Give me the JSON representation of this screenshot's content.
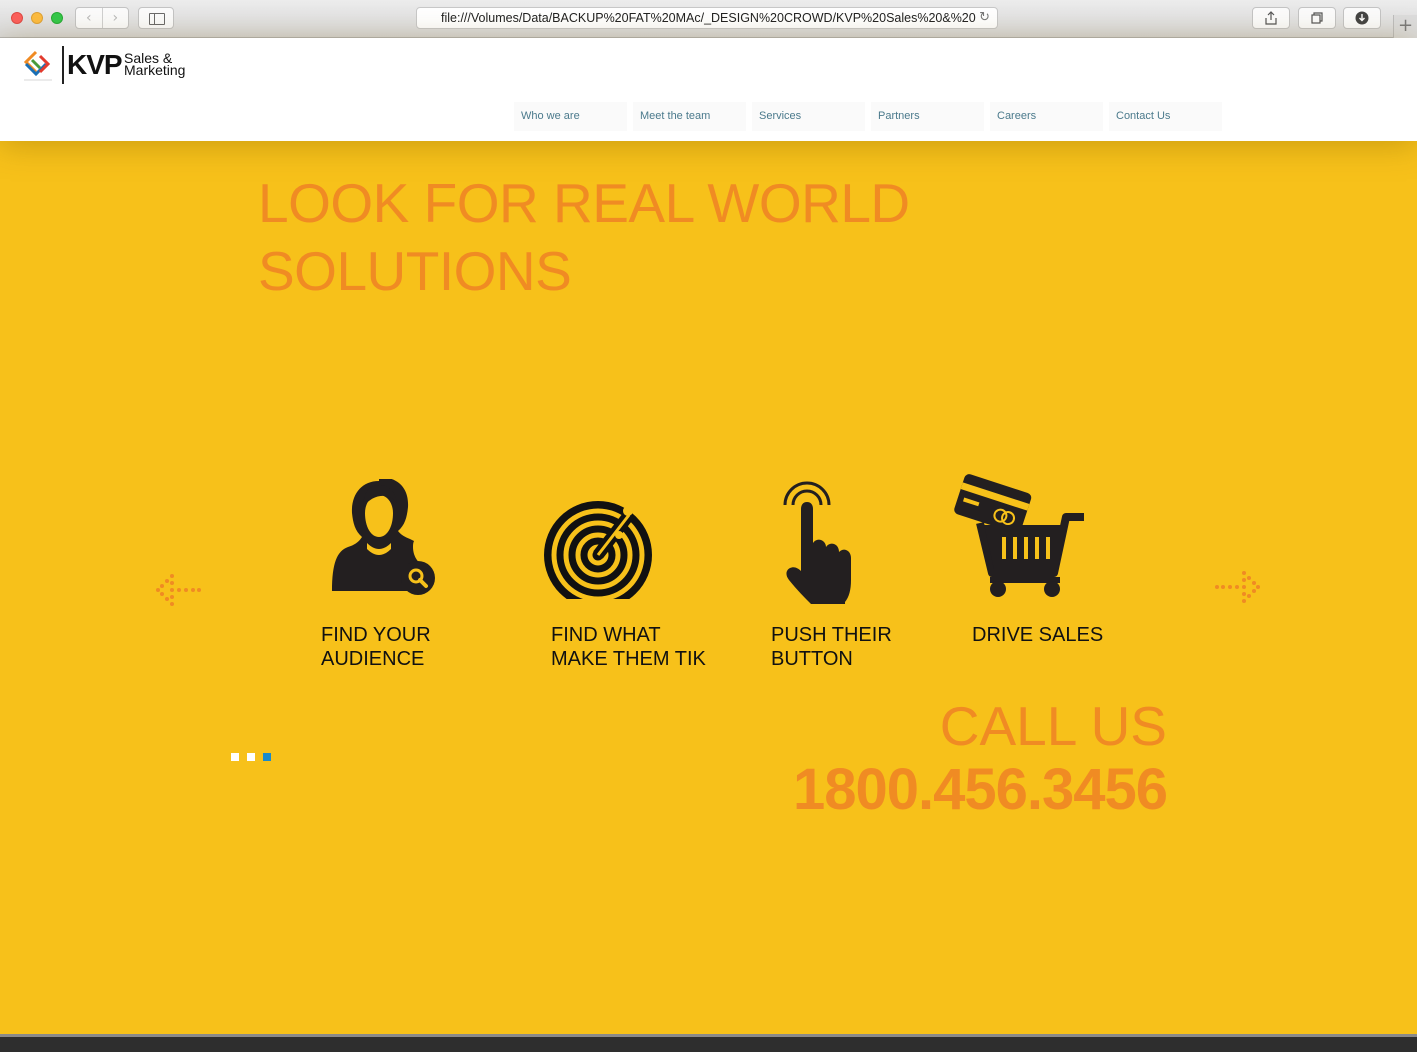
{
  "browser": {
    "url": "file:///Volumes/Data/BACKUP%20FAT%20MAc/_DESIGN%20CROWD/KVP%20Sales%20&%20",
    "back_icon": "chevron-left-icon",
    "forward_icon": "chevron-right-icon",
    "reload_icon": "reload-icon",
    "share_icon": "share-icon",
    "tabs_icon": "tabs-icon",
    "download_icon": "download-icon",
    "newtab_icon": "plus-icon"
  },
  "header": {
    "logo_main": "KVP",
    "logo_sub_line1": "Sales &",
    "logo_sub_line2": "Marketing"
  },
  "nav": {
    "items": [
      {
        "label": "Who we are"
      },
      {
        "label": "Meet the team"
      },
      {
        "label": "Services"
      },
      {
        "label": "Partners"
      },
      {
        "label": "Careers"
      },
      {
        "label": "Contact Us"
      }
    ]
  },
  "hero": {
    "title_line1": "LOOK FOR REAL WORLD",
    "title_line2": "SOLUTIONS",
    "features": [
      {
        "icon": "person-search-icon",
        "line1": "FIND YOUR",
        "line2": "AUDIENCE"
      },
      {
        "icon": "radar-icon",
        "line1": "FIND WHAT",
        "line2": "MAKE THEM TIK"
      },
      {
        "icon": "hand-pointer-icon",
        "line1": "PUSH THEIR",
        "line2": "BUTTON"
      },
      {
        "icon": "shopping-cart-icon",
        "line1": "DRIVE SALES",
        "line2": ""
      }
    ],
    "carousel_slide_count": 3,
    "carousel_active_index": 2,
    "call_label": "CALL US",
    "phone": "1800.456.3456"
  },
  "colors": {
    "background": "#f7c11a",
    "accent": "#f08b23",
    "nav_text": "#4b7a8c",
    "active_dot": "#1a8acb"
  }
}
